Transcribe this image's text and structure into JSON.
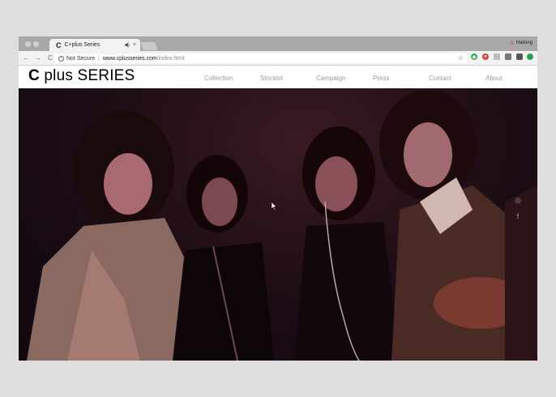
{
  "browser": {
    "tab": {
      "favicon": "C",
      "title": "C+plus Series",
      "audio_icon": "speaker-icon",
      "close_glyph": "×"
    },
    "profile": {
      "name": "Hailong",
      "icon": "person-icon"
    },
    "nav": {
      "back": "←",
      "forward": "→",
      "reload": "C"
    },
    "address": {
      "security": "Not Secure",
      "host": "www.cplusseries.com",
      "path": "/index.html"
    },
    "star": "☆",
    "extensions": [
      "green-circle-icon",
      "red-circle-icon",
      "ghost-icon",
      "cast-icon",
      "puzzle-icon",
      "green-shield-icon"
    ]
  },
  "site": {
    "logo": {
      "mark": "C",
      "rest": "plus SERIES"
    },
    "nav": [
      "Collection",
      "Stockist",
      "Campaign",
      "Press",
      "Contact",
      "About"
    ],
    "social": [
      {
        "icon": "instagram-icon",
        "glyph": "◎"
      },
      {
        "icon": "facebook-icon",
        "glyph": "f"
      }
    ]
  },
  "colors": {
    "page_bg": "#dedede",
    "tabstrip": "#a8a8a8",
    "toolbar": "#f2f2f2",
    "nav_text": "#999999",
    "hero_bg": "#1a0c14"
  }
}
